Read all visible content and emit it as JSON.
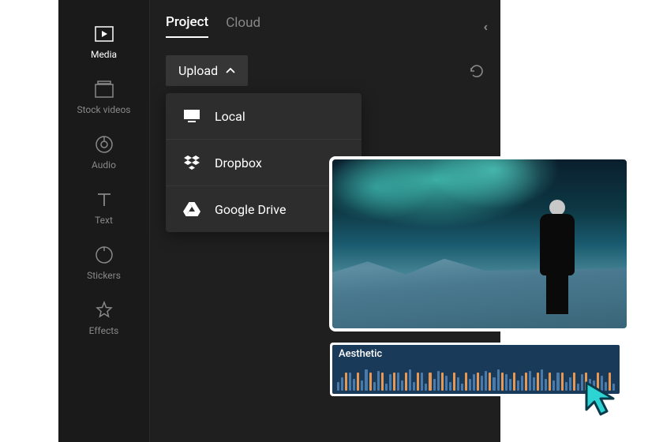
{
  "sidebar": {
    "items": [
      {
        "label": "Media",
        "icon": "media",
        "active": true
      },
      {
        "label": "Stock videos",
        "icon": "stock",
        "active": false
      },
      {
        "label": "Audio",
        "icon": "audio",
        "active": false
      },
      {
        "label": "Text",
        "icon": "text",
        "active": false
      },
      {
        "label": "Stickers",
        "icon": "stickers",
        "active": false
      },
      {
        "label": "Effects",
        "icon": "effects",
        "active": false
      }
    ]
  },
  "tabs": {
    "items": [
      {
        "label": "Project",
        "active": true
      },
      {
        "label": "Cloud",
        "active": false
      }
    ]
  },
  "upload": {
    "label": "Upload",
    "expanded": true,
    "options": [
      {
        "label": "Local",
        "icon": "local"
      },
      {
        "label": "Dropbox",
        "icon": "dropbox"
      },
      {
        "label": "Google Drive",
        "icon": "gdrive"
      }
    ]
  },
  "audio_clip": {
    "label": "Aesthetic"
  }
}
